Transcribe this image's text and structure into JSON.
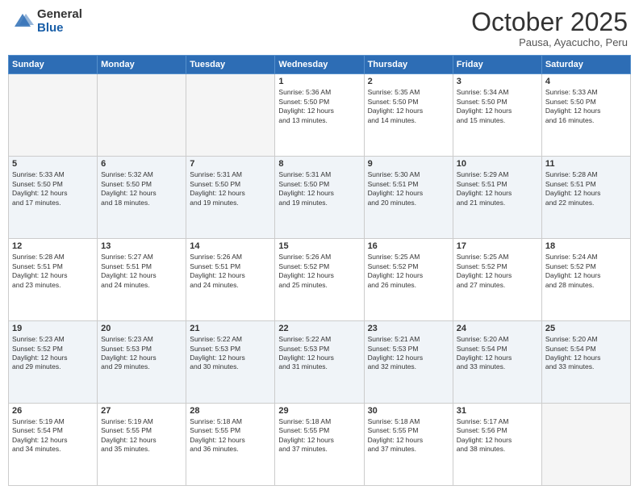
{
  "header": {
    "logo_general": "General",
    "logo_blue": "Blue",
    "month_title": "October 2025",
    "subtitle": "Pausa, Ayacucho, Peru"
  },
  "weekdays": [
    "Sunday",
    "Monday",
    "Tuesday",
    "Wednesday",
    "Thursday",
    "Friday",
    "Saturday"
  ],
  "weeks": [
    [
      {
        "day": "",
        "info": "",
        "empty": true
      },
      {
        "day": "",
        "info": "",
        "empty": true
      },
      {
        "day": "",
        "info": "",
        "empty": true
      },
      {
        "day": "1",
        "info": "Sunrise: 5:36 AM\nSunset: 5:50 PM\nDaylight: 12 hours\nand 13 minutes.",
        "empty": false
      },
      {
        "day": "2",
        "info": "Sunrise: 5:35 AM\nSunset: 5:50 PM\nDaylight: 12 hours\nand 14 minutes.",
        "empty": false
      },
      {
        "day": "3",
        "info": "Sunrise: 5:34 AM\nSunset: 5:50 PM\nDaylight: 12 hours\nand 15 minutes.",
        "empty": false
      },
      {
        "day": "4",
        "info": "Sunrise: 5:33 AM\nSunset: 5:50 PM\nDaylight: 12 hours\nand 16 minutes.",
        "empty": false
      }
    ],
    [
      {
        "day": "5",
        "info": "Sunrise: 5:33 AM\nSunset: 5:50 PM\nDaylight: 12 hours\nand 17 minutes.",
        "empty": false
      },
      {
        "day": "6",
        "info": "Sunrise: 5:32 AM\nSunset: 5:50 PM\nDaylight: 12 hours\nand 18 minutes.",
        "empty": false
      },
      {
        "day": "7",
        "info": "Sunrise: 5:31 AM\nSunset: 5:50 PM\nDaylight: 12 hours\nand 19 minutes.",
        "empty": false
      },
      {
        "day": "8",
        "info": "Sunrise: 5:31 AM\nSunset: 5:50 PM\nDaylight: 12 hours\nand 19 minutes.",
        "empty": false
      },
      {
        "day": "9",
        "info": "Sunrise: 5:30 AM\nSunset: 5:51 PM\nDaylight: 12 hours\nand 20 minutes.",
        "empty": false
      },
      {
        "day": "10",
        "info": "Sunrise: 5:29 AM\nSunset: 5:51 PM\nDaylight: 12 hours\nand 21 minutes.",
        "empty": false
      },
      {
        "day": "11",
        "info": "Sunrise: 5:28 AM\nSunset: 5:51 PM\nDaylight: 12 hours\nand 22 minutes.",
        "empty": false
      }
    ],
    [
      {
        "day": "12",
        "info": "Sunrise: 5:28 AM\nSunset: 5:51 PM\nDaylight: 12 hours\nand 23 minutes.",
        "empty": false
      },
      {
        "day": "13",
        "info": "Sunrise: 5:27 AM\nSunset: 5:51 PM\nDaylight: 12 hours\nand 24 minutes.",
        "empty": false
      },
      {
        "day": "14",
        "info": "Sunrise: 5:26 AM\nSunset: 5:51 PM\nDaylight: 12 hours\nand 24 minutes.",
        "empty": false
      },
      {
        "day": "15",
        "info": "Sunrise: 5:26 AM\nSunset: 5:52 PM\nDaylight: 12 hours\nand 25 minutes.",
        "empty": false
      },
      {
        "day": "16",
        "info": "Sunrise: 5:25 AM\nSunset: 5:52 PM\nDaylight: 12 hours\nand 26 minutes.",
        "empty": false
      },
      {
        "day": "17",
        "info": "Sunrise: 5:25 AM\nSunset: 5:52 PM\nDaylight: 12 hours\nand 27 minutes.",
        "empty": false
      },
      {
        "day": "18",
        "info": "Sunrise: 5:24 AM\nSunset: 5:52 PM\nDaylight: 12 hours\nand 28 minutes.",
        "empty": false
      }
    ],
    [
      {
        "day": "19",
        "info": "Sunrise: 5:23 AM\nSunset: 5:52 PM\nDaylight: 12 hours\nand 29 minutes.",
        "empty": false
      },
      {
        "day": "20",
        "info": "Sunrise: 5:23 AM\nSunset: 5:53 PM\nDaylight: 12 hours\nand 29 minutes.",
        "empty": false
      },
      {
        "day": "21",
        "info": "Sunrise: 5:22 AM\nSunset: 5:53 PM\nDaylight: 12 hours\nand 30 minutes.",
        "empty": false
      },
      {
        "day": "22",
        "info": "Sunrise: 5:22 AM\nSunset: 5:53 PM\nDaylight: 12 hours\nand 31 minutes.",
        "empty": false
      },
      {
        "day": "23",
        "info": "Sunrise: 5:21 AM\nSunset: 5:53 PM\nDaylight: 12 hours\nand 32 minutes.",
        "empty": false
      },
      {
        "day": "24",
        "info": "Sunrise: 5:20 AM\nSunset: 5:54 PM\nDaylight: 12 hours\nand 33 minutes.",
        "empty": false
      },
      {
        "day": "25",
        "info": "Sunrise: 5:20 AM\nSunset: 5:54 PM\nDaylight: 12 hours\nand 33 minutes.",
        "empty": false
      }
    ],
    [
      {
        "day": "26",
        "info": "Sunrise: 5:19 AM\nSunset: 5:54 PM\nDaylight: 12 hours\nand 34 minutes.",
        "empty": false
      },
      {
        "day": "27",
        "info": "Sunrise: 5:19 AM\nSunset: 5:55 PM\nDaylight: 12 hours\nand 35 minutes.",
        "empty": false
      },
      {
        "day": "28",
        "info": "Sunrise: 5:18 AM\nSunset: 5:55 PM\nDaylight: 12 hours\nand 36 minutes.",
        "empty": false
      },
      {
        "day": "29",
        "info": "Sunrise: 5:18 AM\nSunset: 5:55 PM\nDaylight: 12 hours\nand 37 minutes.",
        "empty": false
      },
      {
        "day": "30",
        "info": "Sunrise: 5:18 AM\nSunset: 5:55 PM\nDaylight: 12 hours\nand 37 minutes.",
        "empty": false
      },
      {
        "day": "31",
        "info": "Sunrise: 5:17 AM\nSunset: 5:56 PM\nDaylight: 12 hours\nand 38 minutes.",
        "empty": false
      },
      {
        "day": "",
        "info": "",
        "empty": true
      }
    ]
  ]
}
